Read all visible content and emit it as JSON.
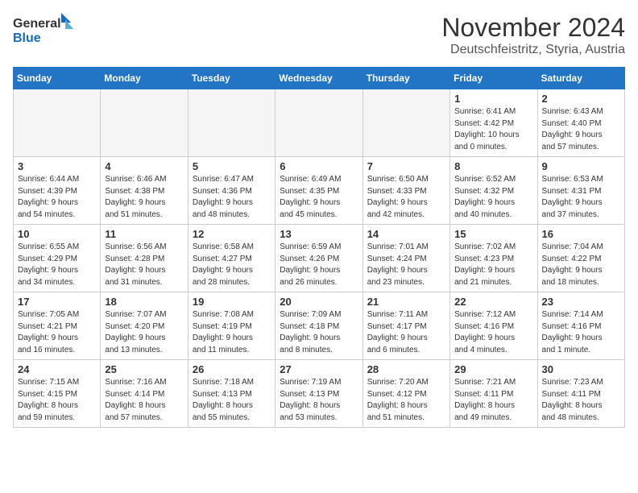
{
  "header": {
    "logo_line1": "General",
    "logo_line2": "Blue",
    "month_title": "November 2024",
    "location": "Deutschfeistritz, Styria, Austria"
  },
  "weekdays": [
    "Sunday",
    "Monday",
    "Tuesday",
    "Wednesday",
    "Thursday",
    "Friday",
    "Saturday"
  ],
  "weeks": [
    [
      {
        "day": "",
        "info": ""
      },
      {
        "day": "",
        "info": ""
      },
      {
        "day": "",
        "info": ""
      },
      {
        "day": "",
        "info": ""
      },
      {
        "day": "",
        "info": ""
      },
      {
        "day": "1",
        "info": "Sunrise: 6:41 AM\nSunset: 4:42 PM\nDaylight: 10 hours\nand 0 minutes."
      },
      {
        "day": "2",
        "info": "Sunrise: 6:43 AM\nSunset: 4:40 PM\nDaylight: 9 hours\nand 57 minutes."
      }
    ],
    [
      {
        "day": "3",
        "info": "Sunrise: 6:44 AM\nSunset: 4:39 PM\nDaylight: 9 hours\nand 54 minutes."
      },
      {
        "day": "4",
        "info": "Sunrise: 6:46 AM\nSunset: 4:38 PM\nDaylight: 9 hours\nand 51 minutes."
      },
      {
        "day": "5",
        "info": "Sunrise: 6:47 AM\nSunset: 4:36 PM\nDaylight: 9 hours\nand 48 minutes."
      },
      {
        "day": "6",
        "info": "Sunrise: 6:49 AM\nSunset: 4:35 PM\nDaylight: 9 hours\nand 45 minutes."
      },
      {
        "day": "7",
        "info": "Sunrise: 6:50 AM\nSunset: 4:33 PM\nDaylight: 9 hours\nand 42 minutes."
      },
      {
        "day": "8",
        "info": "Sunrise: 6:52 AM\nSunset: 4:32 PM\nDaylight: 9 hours\nand 40 minutes."
      },
      {
        "day": "9",
        "info": "Sunrise: 6:53 AM\nSunset: 4:31 PM\nDaylight: 9 hours\nand 37 minutes."
      }
    ],
    [
      {
        "day": "10",
        "info": "Sunrise: 6:55 AM\nSunset: 4:29 PM\nDaylight: 9 hours\nand 34 minutes."
      },
      {
        "day": "11",
        "info": "Sunrise: 6:56 AM\nSunset: 4:28 PM\nDaylight: 9 hours\nand 31 minutes."
      },
      {
        "day": "12",
        "info": "Sunrise: 6:58 AM\nSunset: 4:27 PM\nDaylight: 9 hours\nand 28 minutes."
      },
      {
        "day": "13",
        "info": "Sunrise: 6:59 AM\nSunset: 4:26 PM\nDaylight: 9 hours\nand 26 minutes."
      },
      {
        "day": "14",
        "info": "Sunrise: 7:01 AM\nSunset: 4:24 PM\nDaylight: 9 hours\nand 23 minutes."
      },
      {
        "day": "15",
        "info": "Sunrise: 7:02 AM\nSunset: 4:23 PM\nDaylight: 9 hours\nand 21 minutes."
      },
      {
        "day": "16",
        "info": "Sunrise: 7:04 AM\nSunset: 4:22 PM\nDaylight: 9 hours\nand 18 minutes."
      }
    ],
    [
      {
        "day": "17",
        "info": "Sunrise: 7:05 AM\nSunset: 4:21 PM\nDaylight: 9 hours\nand 16 minutes."
      },
      {
        "day": "18",
        "info": "Sunrise: 7:07 AM\nSunset: 4:20 PM\nDaylight: 9 hours\nand 13 minutes."
      },
      {
        "day": "19",
        "info": "Sunrise: 7:08 AM\nSunset: 4:19 PM\nDaylight: 9 hours\nand 11 minutes."
      },
      {
        "day": "20",
        "info": "Sunrise: 7:09 AM\nSunset: 4:18 PM\nDaylight: 9 hours\nand 8 minutes."
      },
      {
        "day": "21",
        "info": "Sunrise: 7:11 AM\nSunset: 4:17 PM\nDaylight: 9 hours\nand 6 minutes."
      },
      {
        "day": "22",
        "info": "Sunrise: 7:12 AM\nSunset: 4:16 PM\nDaylight: 9 hours\nand 4 minutes."
      },
      {
        "day": "23",
        "info": "Sunrise: 7:14 AM\nSunset: 4:16 PM\nDaylight: 9 hours\nand 1 minute."
      }
    ],
    [
      {
        "day": "24",
        "info": "Sunrise: 7:15 AM\nSunset: 4:15 PM\nDaylight: 8 hours\nand 59 minutes."
      },
      {
        "day": "25",
        "info": "Sunrise: 7:16 AM\nSunset: 4:14 PM\nDaylight: 8 hours\nand 57 minutes."
      },
      {
        "day": "26",
        "info": "Sunrise: 7:18 AM\nSunset: 4:13 PM\nDaylight: 8 hours\nand 55 minutes."
      },
      {
        "day": "27",
        "info": "Sunrise: 7:19 AM\nSunset: 4:13 PM\nDaylight: 8 hours\nand 53 minutes."
      },
      {
        "day": "28",
        "info": "Sunrise: 7:20 AM\nSunset: 4:12 PM\nDaylight: 8 hours\nand 51 minutes."
      },
      {
        "day": "29",
        "info": "Sunrise: 7:21 AM\nSunset: 4:11 PM\nDaylight: 8 hours\nand 49 minutes."
      },
      {
        "day": "30",
        "info": "Sunrise: 7:23 AM\nSunset: 4:11 PM\nDaylight: 8 hours\nand 48 minutes."
      }
    ]
  ]
}
